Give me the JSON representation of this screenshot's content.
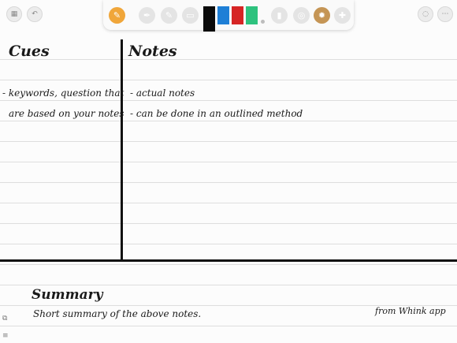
{
  "toolbar": {
    "tools": [
      "pen-tool",
      "fountain-pen-tool",
      "highlighter-tool",
      "eraser-tool"
    ],
    "colors": [
      "#0b0b0b",
      "#1e7fd6",
      "#d62424",
      "#2ec27e"
    ],
    "right_tools": [
      "pencil-tool",
      "lasso-tool",
      "settings-tool",
      "add-tool"
    ]
  },
  "note": {
    "cues_heading": "Cues",
    "notes_heading": "Notes",
    "cue_line1": "- keywords, question that",
    "cue_line2": "are based on your notes",
    "note_line1": "- actual notes",
    "note_line2": "- can be done in an outlined method",
    "summary_heading": "Summary",
    "summary_text": "Short summary of the above notes.",
    "credit": "from Whink app"
  }
}
